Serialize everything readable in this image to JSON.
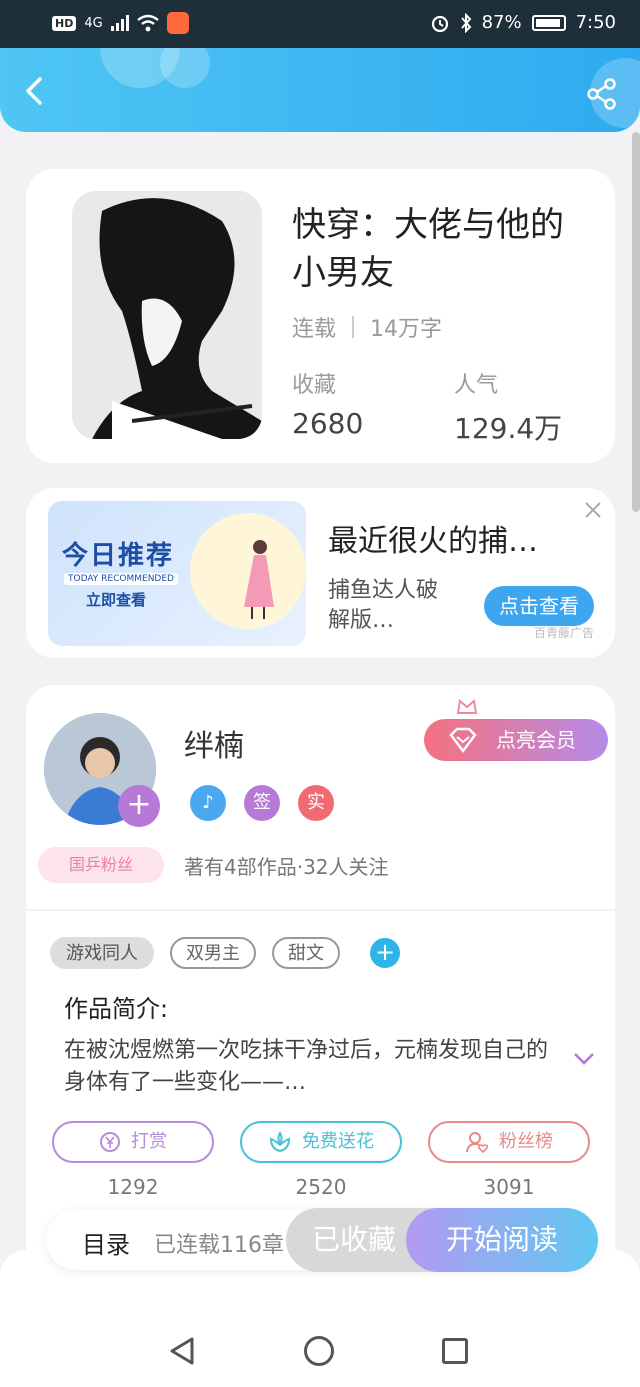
{
  "status_bar": {
    "network_chip": "HD",
    "signal_text": "4G",
    "battery": "87%",
    "time": "7:50"
  },
  "book": {
    "title": "快穿：大佬与他的小男友",
    "status": "连载",
    "word_count": "14万字",
    "favorites_label": "收藏",
    "favorites_value": "2680",
    "popularity_label": "人气",
    "popularity_value": "129.4万"
  },
  "ad": {
    "image_title": "今日推荐",
    "image_subtitle": "TODAY RECOMMENDED",
    "image_cta": "立即查看",
    "title": "最近很火的捕…",
    "description": "捕鱼达人破解版…",
    "button": "点击查看",
    "tag": "百青藤广告"
  },
  "author": {
    "name": "绊楠",
    "fan_badge": "国乒粉丝",
    "vip_button": "点亮会员",
    "badge_sign": "签",
    "badge_real": "实",
    "meta": "著有4部作品·32人关注"
  },
  "tags": [
    "游戏同人",
    "双男主",
    "甜文"
  ],
  "intro": {
    "label": "作品简介:",
    "text": "在被沈煜燃第一次吃抹干净过后，元楠发现自己的身体有了一些变化——…"
  },
  "actions": {
    "reward": "打赏",
    "reward_count": "1292",
    "flower": "免费送花",
    "flower_count": "2520",
    "fans": "粉丝榜",
    "fans_count": "3091"
  },
  "bottom": {
    "toc_label": "目录",
    "toc_status": "已连载116章",
    "favorite_button": "已收藏",
    "read_button": "开始阅读"
  },
  "colors": {
    "header": "#2eaaf0",
    "accent_purple": "#b67ad6",
    "vip_pink": "#f4727f"
  }
}
